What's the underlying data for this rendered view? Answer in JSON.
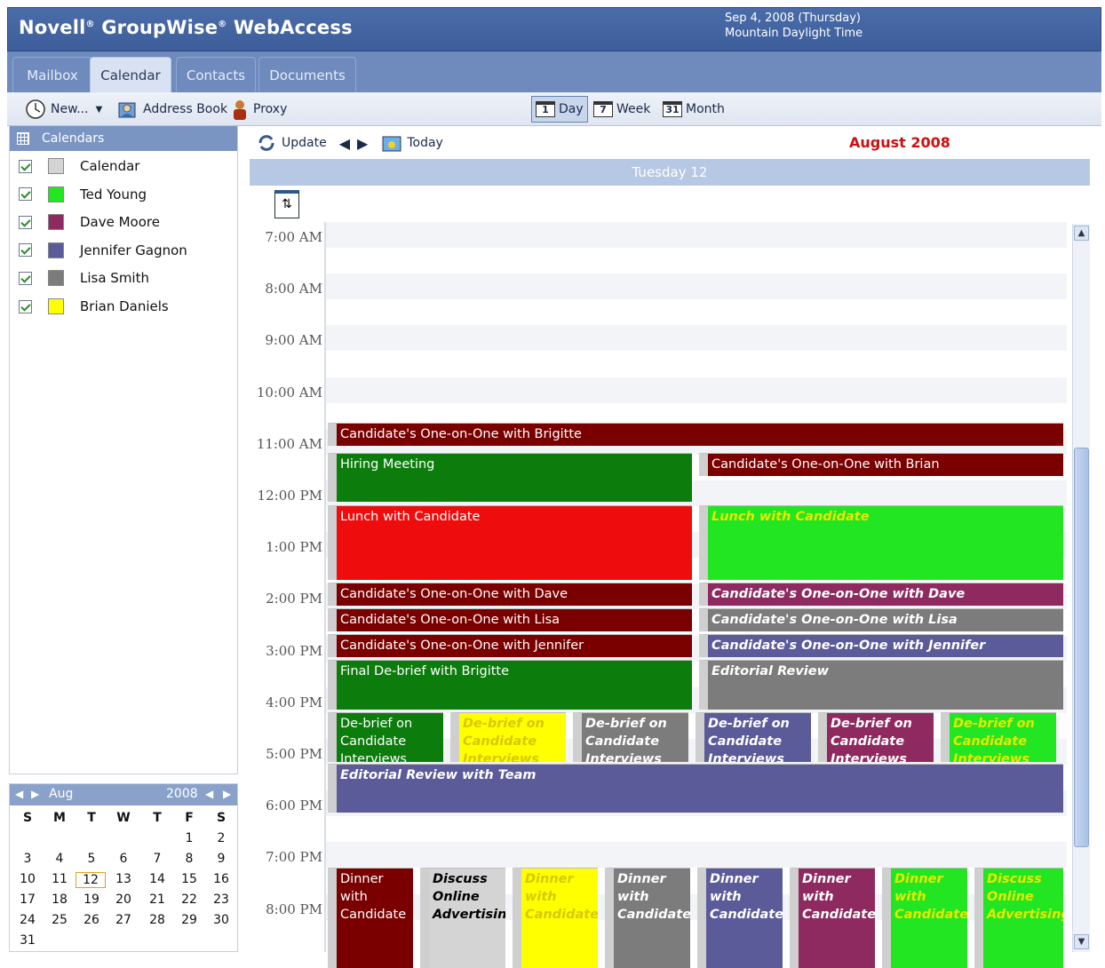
{
  "app": {
    "brand": "Novell",
    "product_mid": "GroupWise",
    "product_end": "WebAccess",
    "date": "Sep 4, 2008 (Thursday)",
    "timezone": "Mountain Daylight Time"
  },
  "tabs": [
    {
      "label": "Mailbox",
      "active": false
    },
    {
      "label": "Calendar",
      "active": true
    },
    {
      "label": "Contacts",
      "active": false
    },
    {
      "label": "Documents",
      "active": false
    }
  ],
  "toolbar": {
    "new_label": "New...",
    "address_book": "Address Book",
    "proxy": "Proxy",
    "views": [
      {
        "num": "1",
        "label": "Day",
        "active": true
      },
      {
        "num": "7",
        "label": "Week",
        "active": false
      },
      {
        "num": "31",
        "label": "Month",
        "active": false
      }
    ]
  },
  "calendars_panel": {
    "title": "Calendars",
    "items": [
      {
        "name": "Calendar",
        "color": "#d4d4d4"
      },
      {
        "name": "Ted Young",
        "color": "#22e622"
      },
      {
        "name": "Dave Moore",
        "color": "#8e2a5f"
      },
      {
        "name": "Jennifer Gagnon",
        "color": "#5b5b9a"
      },
      {
        "name": "Lisa Smith",
        "color": "#7c7c7c"
      },
      {
        "name": "Brian Daniels",
        "color": "#ffff00"
      }
    ]
  },
  "minical": {
    "month": "Aug",
    "year": "2008",
    "day_headers": [
      "S",
      "M",
      "T",
      "W",
      "T",
      "F",
      "S"
    ],
    "weeks": [
      [
        "",
        "",
        "",
        "",
        "",
        "1",
        "2"
      ],
      [
        "3",
        "4",
        "5",
        "6",
        "7",
        "8",
        "9"
      ],
      [
        "10",
        "11",
        "12",
        "13",
        "14",
        "15",
        "16"
      ],
      [
        "17",
        "18",
        "19",
        "20",
        "21",
        "22",
        "23"
      ],
      [
        "24",
        "25",
        "26",
        "27",
        "28",
        "29",
        "30"
      ],
      [
        "31",
        "",
        "",
        "",
        "",
        "",
        ""
      ]
    ],
    "selected": "12"
  },
  "cal_toolbar": {
    "update": "Update",
    "today": "Today",
    "month_label": "August 2008"
  },
  "day_header": "Tuesday 12",
  "times": [
    "7:00 AM",
    "8:00 AM",
    "9:00 AM",
    "10:00 AM",
    "11:00 AM",
    "12:00 PM",
    "1:00 PM",
    "2:00 PM",
    "3:00 PM",
    "4:00 PM",
    "5:00 PM",
    "6:00 PM",
    "7:00 PM",
    "8:00 PM"
  ],
  "events": [
    {
      "title": "Candidate's One-on-One with Brigitte",
      "color": "#7a0000",
      "text": "#ffffff",
      "italic": false
    },
    {
      "title": "Hiring Meeting",
      "color": "#0c7d0c",
      "text": "#ffffff",
      "italic": false
    },
    {
      "title": "Candidate's One-on-One with Brian",
      "color": "#7a0000",
      "text": "#ffffff",
      "italic": false
    },
    {
      "title": "Lunch with Candidate",
      "color": "#ee0c0c",
      "text": "#ffffff",
      "italic": false
    },
    {
      "title": "Lunch with Candidate",
      "color": "#22e622",
      "text": "#e8e800",
      "italic": true
    },
    {
      "title": "Candidate's One-on-One with Dave",
      "color": "#7a0000",
      "text": "#ffffff",
      "italic": false
    },
    {
      "title": "Candidate's One-on-One with Dave",
      "color": "#8e2a5f",
      "text": "#ffffff",
      "italic": true
    },
    {
      "title": "Candidate's One-on-One with Lisa",
      "color": "#7a0000",
      "text": "#ffffff",
      "italic": false
    },
    {
      "title": "Candidate's One-on-One with Lisa",
      "color": "#7c7c7c",
      "text": "#ffffff",
      "italic": true
    },
    {
      "title": "Candidate's One-on-One with Jennifer",
      "color": "#7a0000",
      "text": "#ffffff",
      "italic": false
    },
    {
      "title": "Candidate's One-on-One with Jennifer",
      "color": "#5b5b9a",
      "text": "#ffffff",
      "italic": true
    },
    {
      "title": "Final De-brief with Brigitte",
      "color": "#0c7d0c",
      "text": "#ffffff",
      "italic": false
    },
    {
      "title": "Editorial Review",
      "color": "#7c7c7c",
      "text": "#ffffff",
      "italic": true
    },
    {
      "title": "De-brief on Candidate Interviews",
      "color": "#0c7d0c",
      "text": "#ffffff",
      "italic": false
    },
    {
      "title": "De-brief on Candidate Interviews",
      "color": "#ffff00",
      "text": "#d8c800",
      "italic": true
    },
    {
      "title": "De-brief on Candidate Interviews",
      "color": "#7c7c7c",
      "text": "#ffffff",
      "italic": true
    },
    {
      "title": "De-brief on Candidate Interviews",
      "color": "#5b5b9a",
      "text": "#ffffff",
      "italic": true
    },
    {
      "title": "De-brief on Candidate Interviews",
      "color": "#8e2a5f",
      "text": "#ffffff",
      "italic": true
    },
    {
      "title": "De-brief on Candidate Interviews",
      "color": "#22e622",
      "text": "#e8e800",
      "italic": true
    },
    {
      "title": "Editorial Review with Team",
      "color": "#5b5b9a",
      "text": "#ffffff",
      "italic": true
    },
    {
      "title": "Dinner with Candidate",
      "color": "#7a0000",
      "text": "#ffffff",
      "italic": false
    },
    {
      "title": "Discuss Online Advertising",
      "color": "#d4d4d4",
      "text": "#000000",
      "italic": true
    },
    {
      "title": "Dinner with Candidate",
      "color": "#ffff00",
      "text": "#d8c800",
      "italic": true
    },
    {
      "title": "Dinner with Candidate",
      "color": "#7c7c7c",
      "text": "#ffffff",
      "italic": true
    },
    {
      "title": "Dinner with Candidate",
      "color": "#5b5b9a",
      "text": "#ffffff",
      "italic": true
    },
    {
      "title": "Dinner with Candidate",
      "color": "#8e2a5f",
      "text": "#ffffff",
      "italic": true
    },
    {
      "title": "Dinner with Candidate",
      "color": "#22e622",
      "text": "#e8e800",
      "italic": true
    },
    {
      "title": "Discuss Online Advertising",
      "color": "#22e622",
      "text": "#e8e800",
      "italic": true
    }
  ]
}
